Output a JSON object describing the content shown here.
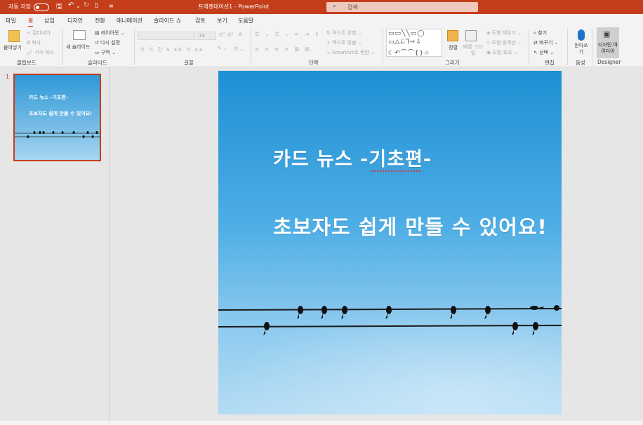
{
  "titlebar": {
    "autosave_label": "자동 저장",
    "doc_title": "프레젠테이션1 - PowerPoint",
    "search_placeholder": "검색"
  },
  "tabs": [
    "파일",
    "홈",
    "삽입",
    "디자인",
    "전환",
    "애니메이션",
    "슬라이드 쇼",
    "검토",
    "보기",
    "도움말"
  ],
  "active_tab": "홈",
  "ribbon": {
    "clipboard": {
      "paste": "붙여넣기",
      "cut": "잘라내기",
      "copy": "복사",
      "format_painter": "서식 복사",
      "group": "클립보드"
    },
    "slides": {
      "new_slide": "새 슬라이드",
      "layout": "레이아웃",
      "reset": "다시 설정",
      "section": "구역",
      "group": "슬라이드"
    },
    "font": {
      "size": "18",
      "group": "글꼴"
    },
    "paragraph": {
      "text_direction": "텍스트 방향",
      "align_text": "텍스트 맞춤",
      "smartart": "SmartArt로 변환",
      "group": "단락"
    },
    "drawing": {
      "arrange": "정렬",
      "quick_styles": "빠른 스타일",
      "shape_fill": "도형 채우기",
      "shape_outline": "도형 윤곽선",
      "shape_effects": "도형 효과",
      "group": "그리기"
    },
    "editing": {
      "find": "찾기",
      "replace": "바꾸기",
      "select": "선택",
      "group": "편집"
    },
    "voice": {
      "dictate": "받아쓰기",
      "group": "음성"
    },
    "designer": {
      "design_ideas": "디자인 아이디어",
      "group": "Designer"
    }
  },
  "slides_panel": {
    "number": "1",
    "thumb_title": "카드 뉴스 -기초편-",
    "thumb_subtitle": "초보자도 쉽게 만들 수 있어요!"
  },
  "slide": {
    "title": "카드 뉴스 -기초편-",
    "subtitle": "초보자도 쉽게 만들 수 있어요!"
  },
  "colors": {
    "accent": "#c43e1c",
    "sky_top": "#1e8fd4",
    "sky_bottom": "#b3dcf4"
  }
}
